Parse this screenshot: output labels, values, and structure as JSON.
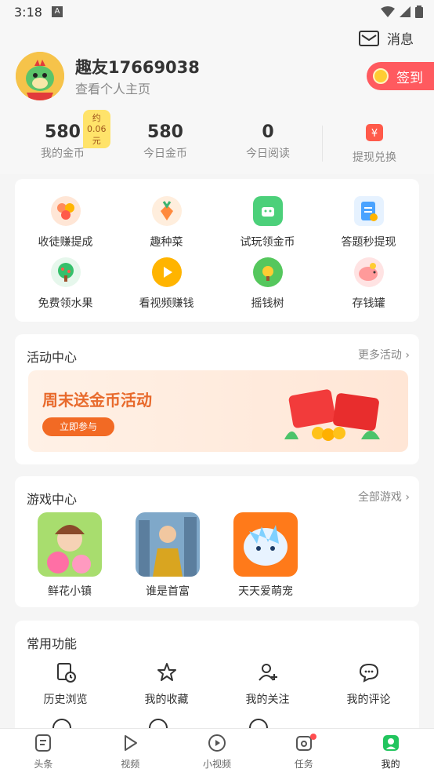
{
  "status_bar": {
    "time": "3:18",
    "icons": [
      "a-icon",
      "wifi-icon",
      "signal-icon",
      "battery-icon"
    ]
  },
  "header": {
    "message_label": "消息",
    "username": "趣友17669038",
    "subtitle": "查看个人主页",
    "signin_label": "签到"
  },
  "stats": [
    {
      "value": "580",
      "label": "我的金币",
      "badge": "约0.06元"
    },
    {
      "value": "580",
      "label": "今日金币"
    },
    {
      "value": "0",
      "label": "今日阅读"
    },
    {
      "label": "提现兑换",
      "icon": "withdraw-icon"
    }
  ],
  "quick_grid": [
    {
      "label": "收徒赚提成",
      "icon": "coins-icon",
      "color": "#ff8a5c"
    },
    {
      "label": "趣种菜",
      "icon": "carrot-icon",
      "color": "#ff8a3d"
    },
    {
      "label": "试玩领金币",
      "icon": "android-icon",
      "color": "#4cd07a"
    },
    {
      "label": "答题秒提现",
      "icon": "quiz-doc-icon",
      "color": "#4aa3ff"
    },
    {
      "label": "免费领水果",
      "icon": "tree-icon",
      "color": "#35c06b"
    },
    {
      "label": "看视频赚钱",
      "icon": "play-coin-icon",
      "color": "#ffb400"
    },
    {
      "label": "摇钱树",
      "icon": "money-tree-icon",
      "color": "#55c75d"
    },
    {
      "label": "存钱罐",
      "icon": "piggy-bank-icon",
      "color": "#ff9a9a"
    }
  ],
  "activity": {
    "title": "活动中心",
    "more": "更多活动",
    "banner_title": "周末送金币活动",
    "banner_button": "立即参与"
  },
  "games": {
    "title": "游戏中心",
    "more": "全部游戏",
    "items": [
      {
        "name": "鲜花小镇"
      },
      {
        "name": "谁是首富"
      },
      {
        "name": "天天爱萌宠"
      }
    ]
  },
  "functions": {
    "title": "常用功能",
    "items": [
      {
        "label": "历史浏览",
        "icon": "history-icon"
      },
      {
        "label": "我的收藏",
        "icon": "star-icon"
      },
      {
        "label": "我的关注",
        "icon": "follow-user-icon"
      },
      {
        "label": "我的评论",
        "icon": "comment-icon"
      }
    ]
  },
  "tabbar": [
    {
      "label": "头条",
      "icon": "news-icon"
    },
    {
      "label": "视频",
      "icon": "video-icon"
    },
    {
      "label": "小视频",
      "icon": "short-video-icon"
    },
    {
      "label": "任务",
      "icon": "task-icon"
    },
    {
      "label": "我的",
      "icon": "profile-icon",
      "active": true
    }
  ],
  "colors": {
    "accent": "#22c55e",
    "signin": "#ff5a5f",
    "banner_text": "#e86a2c"
  }
}
